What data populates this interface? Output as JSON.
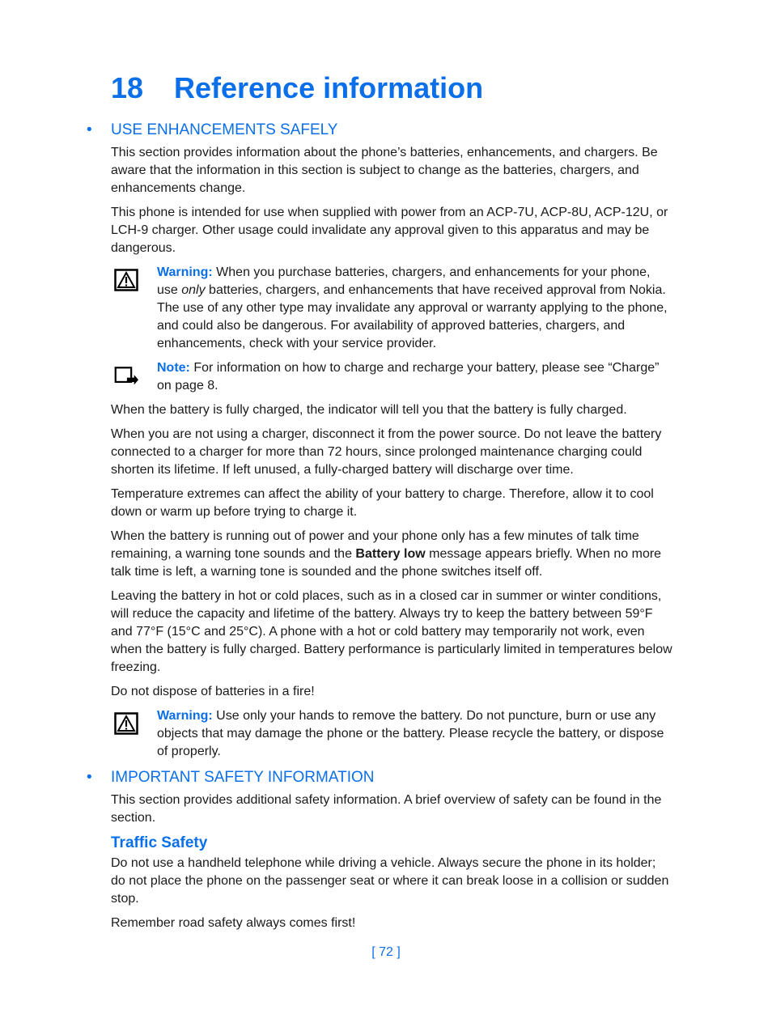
{
  "chapter": {
    "number": "18",
    "title": "Reference information"
  },
  "sections": {
    "enhancements": {
      "heading": "USE ENHANCEMENTS SAFELY",
      "p1": "This section provides information about the phone’s batteries, enhancements, and chargers. Be aware that the information in this section is subject to change as the batteries, chargers, and enhancements change.",
      "p2": "This phone is intended for use when supplied with power from an ACP-7U, ACP-8U, ACP-12U, or LCH-9 charger. Other usage could invalidate any approval given to this apparatus and may be dangerous.",
      "warning1": {
        "label": "Warning:",
        "pre": " When you purchase batteries, chargers, and enhancements for your phone, use ",
        "emph": "only",
        "post": " batteries, chargers, and enhancements that have received approval from Nokia. The use of any other type may invalidate any approval or warranty applying to the phone, and could also be dangerous. For availability of approved batteries, chargers, and enhancements, check with your service provider."
      },
      "note1": {
        "label": "Note:",
        "text": " For information on how to charge and recharge your battery, please see “Charge” on page 8."
      },
      "p3": "When the battery is fully charged, the indicator will tell you that the battery is fully charged.",
      "p4": "When you are not using a charger, disconnect it from the power source. Do not leave the battery connected to a charger for more than 72 hours, since prolonged maintenance charging could shorten its lifetime. If left unused, a fully-charged battery will discharge over time.",
      "p5": "Temperature extremes can affect the ability of your battery to charge. Therefore, allow it to cool down or warm up before trying to charge it.",
      "p6": {
        "pre": "When the battery is running out of power and your phone only has a few minutes of talk time remaining, a warning tone sounds and the ",
        "bold": "Battery low",
        "post": " message appears briefly. When no more talk time is left, a warning tone is sounded and the phone switches itself off."
      },
      "p7": "Leaving the battery in hot or cold places, such as in a closed car in summer or winter conditions, will reduce the capacity and lifetime of the battery. Always try to keep the battery between 59°F and 77°F (15°C and 25°C). A phone with a hot or cold battery may temporarily not work, even when the battery is fully charged. Battery performance is particularly limited in temperatures below freezing.",
      "p8": "Do not dispose of batteries in a fire!",
      "warning2": {
        "label": "Warning:",
        "text": " Use only your hands to remove the battery. Do not puncture, burn or use any objects that may damage the phone or the battery. Please recycle the battery, or dispose of properly."
      }
    },
    "safety": {
      "heading": "IMPORTANT SAFETY INFORMATION",
      "p1": "This section provides additional safety information. A brief overview of safety can be found in the section.",
      "traffic": {
        "heading": "Traffic Safety",
        "p1": "Do not use a handheld telephone while driving a vehicle. Always secure the phone in its holder; do not place the phone on the passenger seat or where it can break loose in a collision or sudden stop.",
        "p2": "Remember road safety always comes first!"
      }
    }
  },
  "bullet": "•",
  "footer": {
    "page": "[ 72 ]"
  },
  "colors": {
    "accent": "#0a6fe8",
    "text": "#1a1a1a"
  }
}
